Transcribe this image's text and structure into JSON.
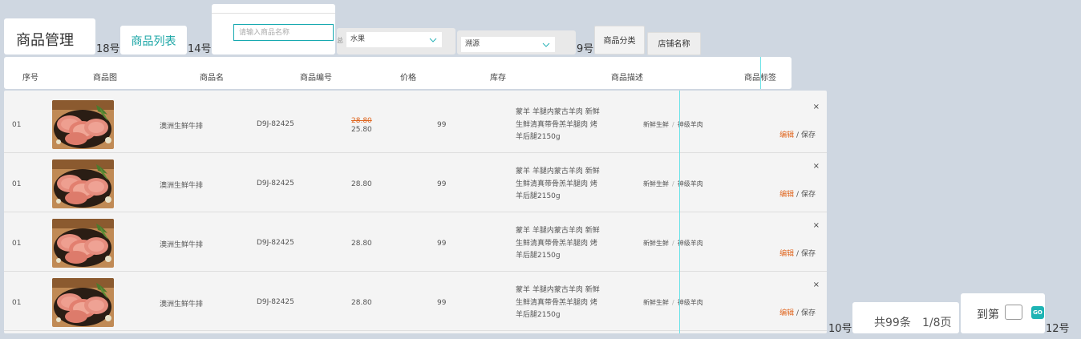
{
  "header": {
    "title": "商品管理",
    "tab": "商品列表",
    "search_placeholder": "请输入商品名称",
    "select_category": "水果",
    "select_origin": "溯源",
    "btn_category": "商品分类",
    "btn_store": "店铺名称",
    "select_mark": "总"
  },
  "notes": {
    "n18": "18号",
    "n14": "14号",
    "n9": "9号",
    "n10": "10号",
    "n12": "12号"
  },
  "columns": [
    "序号",
    "商品图",
    "商品名",
    "商品编号",
    "价格",
    "库存",
    "商品描述",
    "商品标签"
  ],
  "rows": [
    {
      "index": "01",
      "name": "澳洲生鲜牛排",
      "code": "D9J-82425",
      "old_price": "28.80",
      "price": "25.80",
      "stock": "99",
      "desc1": "蒙羊 羊腿内蒙古羊肉 新鲜",
      "desc2": "生鲜清真带骨羔羊腿肉 烤",
      "desc3": "羊后腿2150g",
      "tag1": "新鲜生鲜",
      "tag_sep": "/",
      "tag2": "神级羊肉",
      "edit": "编辑",
      "action_sep": " / ",
      "save": "保存",
      "close": "×"
    },
    {
      "index": "01",
      "name": "澳洲生鲜牛排",
      "code": "D9J-82425",
      "old_price": "",
      "price": "28.80",
      "stock": "99",
      "desc1": "蒙羊 羊腿内蒙古羊肉 新鲜",
      "desc2": "生鲜清真带骨羔羊腿肉 烤",
      "desc3": "羊后腿2150g",
      "tag1": "新鲜生鲜",
      "tag_sep": "/",
      "tag2": "神级羊肉",
      "edit": "编辑",
      "action_sep": " / ",
      "save": "保存",
      "close": "×"
    },
    {
      "index": "01",
      "name": "澳洲生鲜牛排",
      "code": "D9J-82425",
      "old_price": "",
      "price": "28.80",
      "stock": "99",
      "desc1": "蒙羊 羊腿内蒙古羊肉 新鲜",
      "desc2": "生鲜清真带骨羔羊腿肉 烤",
      "desc3": "羊后腿2150g",
      "tag1": "新鲜生鲜",
      "tag_sep": "/",
      "tag2": "神级羊肉",
      "edit": "编辑",
      "action_sep": " / ",
      "save": "保存",
      "close": "×"
    },
    {
      "index": "01",
      "name": "澳洲生鲜牛排",
      "code": "D9J-82425",
      "old_price": "",
      "price": "28.80",
      "stock": "99",
      "desc1": "蒙羊 羊腿内蒙古羊肉 新鲜",
      "desc2": "生鲜清真带骨羔羊腿肉 烤",
      "desc3": "羊后腿2150g",
      "tag1": "新鲜生鲜",
      "tag_sep": "/",
      "tag2": "神级羊肉",
      "edit": "编辑",
      "action_sep": " / ",
      "save": "保存",
      "close": "×"
    }
  ],
  "footer": {
    "total": "共99条",
    "pages": "1/8页",
    "goto": "到第",
    "go": "GO"
  },
  "colors": {
    "accent": "#19a5a5",
    "edit": "#e0661f",
    "background": "#cfd7e1"
  }
}
